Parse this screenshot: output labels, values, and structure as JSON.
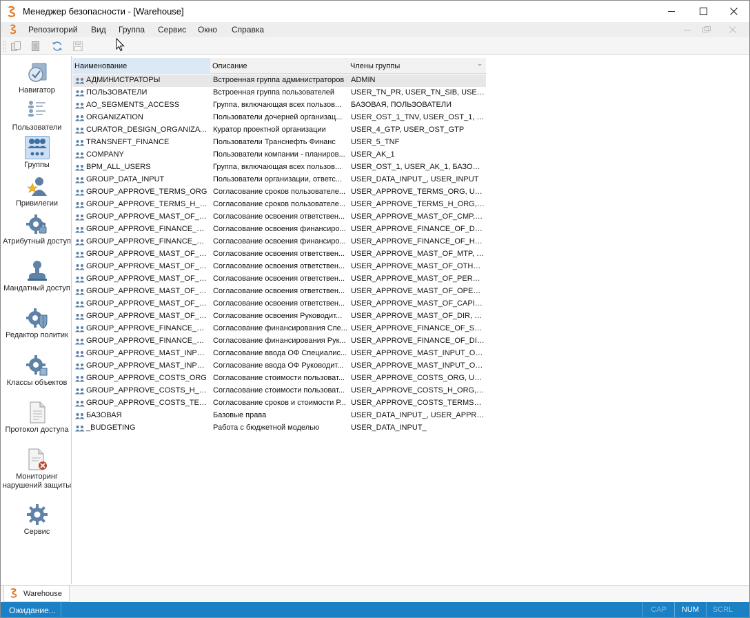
{
  "window": {
    "title": "Менеджер безопасности - [Warehouse]",
    "controls": {
      "minimize": "minimize-icon",
      "maximize": "maximize-icon",
      "close": "close-icon"
    }
  },
  "menubar": {
    "items": [
      "Репозиторий",
      "Вид",
      "Группа",
      "Сервис",
      "Окно",
      "Справка"
    ]
  },
  "toolbar": {
    "buttons": [
      "copy-icon",
      "document-icon",
      "refresh-icon",
      "save-icon"
    ]
  },
  "sidebar": {
    "items": [
      {
        "label": "Навигатор",
        "icon": "navigator-icon"
      },
      {
        "label": "Пользователи",
        "icon": "users-list-icon"
      },
      {
        "label": "Группы",
        "icon": "groups-icon",
        "selected": true
      },
      {
        "label": "Привилегии",
        "icon": "privileges-icon"
      },
      {
        "label": "Атрибутный доступ",
        "icon": "attribute-access-icon"
      },
      {
        "label": "Мандатный доступ",
        "icon": "mandatory-access-icon"
      },
      {
        "label": "Редактор политик",
        "icon": "policy-editor-icon"
      },
      {
        "label": "Классы объектов",
        "icon": "object-classes-icon"
      },
      {
        "label": "Протокол доступа",
        "icon": "access-log-icon"
      },
      {
        "label": "Мониторинг нарушений защиты",
        "icon": "violation-monitor-icon"
      },
      {
        "label": "Сервис",
        "icon": "service-gear-icon"
      }
    ]
  },
  "grid": {
    "columns": [
      "Наименование",
      "Описание",
      "Члены группы"
    ],
    "rows": [
      {
        "name": "АДМИНИСТРАТОРЫ",
        "desc": "Встроенная группа администраторов",
        "members": "ADMIN",
        "selected": true
      },
      {
        "name": "ПОЛЬЗОВАТЕЛИ",
        "desc": "Встроенная группа пользователей",
        "members": "USER_TN_PR, USER_TN_SIB, USER_..."
      },
      {
        "name": "AO_SEGMENTS_ACCESS",
        "desc": "Группа, включающая всех пользов...",
        "members": "БАЗОВАЯ, ПОЛЬЗОВАТЕЛИ"
      },
      {
        "name": "ORGANIZATION",
        "desc": "Пользователи дочерней организац...",
        "members": "USER_OST_1_TNV, USER_OST_1, US..."
      },
      {
        "name": "CURATOR_DESIGN_ORGANIZATION",
        "desc": "Куратор проектной организации",
        "members": "USER_4_GTP, USER_OST_GTP"
      },
      {
        "name": "TRANSNEFT_FINANCE",
        "desc": "Пользователи Транснефть Финанс",
        "members": "USER_5_TNF"
      },
      {
        "name": "COMPANY",
        "desc": "Пользователи компании - планиров...",
        "members": "USER_AK_1"
      },
      {
        "name": "BPM_ALL_USERS",
        "desc": "Группа, включающая всех пользов...",
        "members": "USER_OST_1, USER_AK_1, БАЗОВАЯ"
      },
      {
        "name": "GROUP_DATA_INPUT",
        "desc": "Пользователи организации, ответс...",
        "members": "USER_DATA_INPUT_, USER_INPUT"
      },
      {
        "name": "GROUP_APPROVE_TERMS_ORG",
        "desc": "Согласование сроков пользователе...",
        "members": "USER_APPROVE_TERMS_ORG, USER..."
      },
      {
        "name": "GROUP_APPROVE_TERMS_H_ORG",
        "desc": "Согласование сроков пользователе...",
        "members": "USER_APPROVE_TERMS_H_ORG, US..."
      },
      {
        "name": "GROUP_APPROVE_MAST_OF_CMP",
        "desc": "Согласование освоения ответствен...",
        "members": "USER_APPROVE_MAST_OF_CMP, US..."
      },
      {
        "name": "GROUP_APPROVE_FINANCE_OF_...",
        "desc": "Согласование освоения финансиро...",
        "members": "USER_APPROVE_FINANCE_OF_D_OR..."
      },
      {
        "name": "GROUP_APPROVE_FINANCE_OF_...",
        "desc": "Согласование освоения финансиро...",
        "members": "USER_APPROVE_FINANCE_OF_H_OR..."
      },
      {
        "name": "GROUP_APPROVE_MAST_OF_MTP",
        "desc": "Согласование освоения ответствен...",
        "members": "USER_APPROVE_MAST_OF_MTP, USE..."
      },
      {
        "name": "GROUP_APPROVE_MAST_OF_OTH...",
        "desc": "Согласование освоения ответствен...",
        "members": "USER_APPROVE_MAST_OF_OTHER, ..."
      },
      {
        "name": "GROUP_APPROVE_MAST_OF_PER...",
        "desc": "Согласование освоения ответствен...",
        "members": "USER_APPROVE_MAST_OF_PERCENT..."
      },
      {
        "name": "GROUP_APPROVE_MAST_OF_OPE...",
        "desc": "Согласование освоения ответствен...",
        "members": "USER_APPROVE_MAST_OF_OPERAT,..."
      },
      {
        "name": "GROUP_APPROVE_MAST_OF_CAP...",
        "desc": "Согласование освоения ответствен...",
        "members": "USER_APPROVE_MAST_OF_CAPITAL,..."
      },
      {
        "name": "GROUP_APPROVE_MAST_OF_DIR",
        "desc": "Согласование освоения Руководит...",
        "members": "USER_APPROVE_MAST_OF_DIR, USE..."
      },
      {
        "name": "GROUP_APPROVE_FINANCE_OF_...",
        "desc": "Согласование финансирования Спе...",
        "members": "USER_APPROVE_FINANCE_OF_SPEC..."
      },
      {
        "name": "GROUP_APPROVE_FINANCE_OF_...",
        "desc": "Согласование финансирования Рук...",
        "members": "USER_APPROVE_FINANCE_OF_DIR_..."
      },
      {
        "name": "GROUP_APPROVE_MAST_INPUT_...",
        "desc": "Согласование ввода ОФ Специалис...",
        "members": "USER_APPROVE_MAST_INPUT_OF_S..."
      },
      {
        "name": "GROUP_APPROVE_MAST_INPUT_...",
        "desc": "Согласование ввода ОФ Руководит...",
        "members": "USER_APPROVE_MAST_INPUT_OF_D..."
      },
      {
        "name": "GROUP_APPROVE_COSTS_ORG",
        "desc": "Согласование стоимости пользоват...",
        "members": "USER_APPROVE_COSTS_ORG, USER..."
      },
      {
        "name": "GROUP_APPROVE_COSTS_H_ORG",
        "desc": "Согласование стоимости пользоват...",
        "members": "USER_APPROVE_COSTS_H_ORG, US..."
      },
      {
        "name": "GROUP_APPROVE_COSTS_TERMS...",
        "desc": "Согласование сроков и стоимости Р...",
        "members": "USER_APPROVE_COSTS_TERMS_D_O..."
      },
      {
        "name": "БАЗОВАЯ",
        "desc": "Базовые права",
        "members": "USER_DATA_INPUT_, USER_APPROV..."
      },
      {
        "name": "_BUDGETING",
        "desc": "Работа с бюджетной моделью",
        "members": "USER_DATA_INPUT_"
      }
    ]
  },
  "tabs": [
    {
      "label": "Warehouse"
    }
  ],
  "status": {
    "text": "Ожидание...",
    "indicators": [
      "CAP",
      "NUM",
      "SCRL"
    ],
    "active": [
      "NUM"
    ]
  },
  "colors": {
    "accent": "#1b80c4",
    "logo": "#e8761b"
  }
}
